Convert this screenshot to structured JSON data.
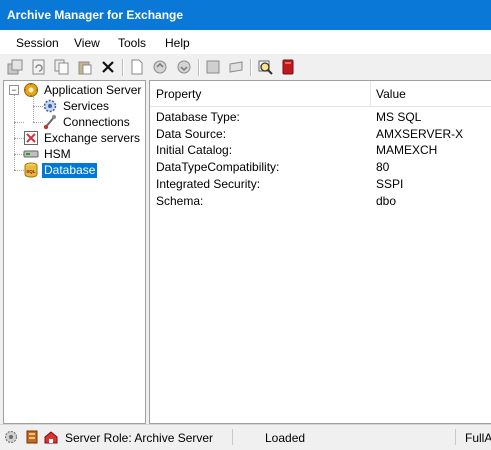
{
  "window": {
    "title": "Archive Manager for Exchange"
  },
  "menu": {
    "items": [
      "Session",
      "View",
      "Tools",
      "Help"
    ]
  },
  "toolbar": {
    "icons": [
      "properties-icon",
      "refresh-icon",
      "copy-icon",
      "paste-icon",
      "delete-icon",
      "new-document-icon",
      "sync-icon",
      "sync-alt-icon",
      "note-icon",
      "mail-icon",
      "search-icon",
      "book-icon"
    ]
  },
  "tree": {
    "items": [
      {
        "label": "Application Server",
        "icon": "application-server-icon"
      },
      {
        "label": "Services",
        "icon": "services-gear-icon"
      },
      {
        "label": "Connections",
        "icon": "connections-icon"
      },
      {
        "label": "Exchange servers",
        "icon": "exchange-servers-icon"
      },
      {
        "label": "HSM",
        "icon": "hsm-icon"
      },
      {
        "label": "Database",
        "icon": "database-icon",
        "selected": true
      }
    ]
  },
  "grid": {
    "columns": [
      "Property",
      "Value"
    ],
    "rows": [
      {
        "property": "Database Type:",
        "value": "MS SQL"
      },
      {
        "property": "Data Source:",
        "value": "AMXSERVER-X"
      },
      {
        "property": "Initial Catalog:",
        "value": "MAMEXCH"
      },
      {
        "property": "DataTypeCompatibility:",
        "value": "80"
      },
      {
        "property": "Integrated Security:",
        "value": "SSPI"
      },
      {
        "property": "Schema:",
        "value": "dbo"
      }
    ]
  },
  "status": {
    "role": "Server Role: Archive Server",
    "state": "Loaded",
    "edition": "FullA"
  }
}
